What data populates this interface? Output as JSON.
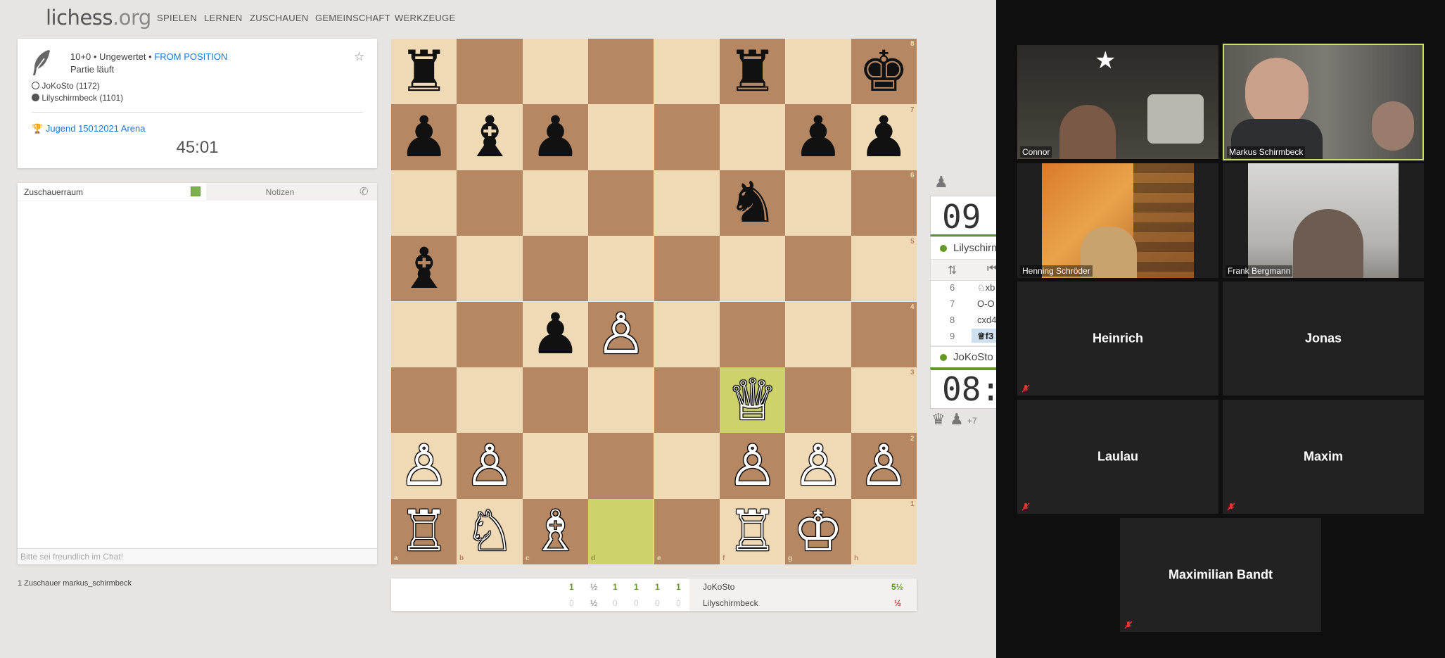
{
  "header": {
    "logo_main": "lichess",
    "logo_tld": ".org",
    "nav": [
      "SPIELEN",
      "LERNEN",
      "ZUSCHAUEN",
      "GEMEINSCHAFT",
      "WERKZEUGE"
    ]
  },
  "game": {
    "setup": "10+0 • Ungewertet •",
    "from_position": "FROM POSITION",
    "status": "Partie läuft",
    "white_player": "JoKoSto (1172)",
    "black_player": "Lilyschirmbeck (1101)",
    "tournament": "Jugend 15012021 Arena",
    "tournament_clock": "45:01"
  },
  "chat": {
    "tab_chat": "Zuschauerraum",
    "tab_notes": "Notizen",
    "placeholder": "Bitte sei freundlich im Chat!",
    "spectators": "1 Zuschauer markus_schirmbeck"
  },
  "board": {
    "files": [
      "a",
      "b",
      "c",
      "d",
      "e",
      "f",
      "g",
      "h"
    ],
    "ranks": [
      "8",
      "7",
      "6",
      "5",
      "4",
      "3",
      "2",
      "1"
    ]
  },
  "crosstable": {
    "row1": [
      "1",
      "½",
      "1",
      "1",
      "1",
      "1"
    ],
    "row2": [
      "0",
      "½",
      "0",
      "0",
      "0",
      "0"
    ],
    "player1": "JoKoSto",
    "player2": "Lilyschirmbeck",
    "score1": "5½",
    "score2": "½"
  },
  "clocks": {
    "top_time": "09",
    "top_player": "Lilyschirm",
    "moves": [
      {
        "num": "6",
        "move": "♘xb"
      },
      {
        "num": "7",
        "move": "O-O"
      },
      {
        "num": "8",
        "move": "cxd4"
      },
      {
        "num": "9",
        "move": "♕f3"
      }
    ],
    "bottom_player": "JoKoSto",
    "bottom_time": "08:",
    "material": "+7"
  },
  "zoom": {
    "tiles": [
      {
        "name": "Connor"
      },
      {
        "name": "Markus Schirmbeck"
      },
      {
        "name": "Henning Schröder"
      },
      {
        "name": "Frank Bergmann"
      },
      {
        "name": "Heinrich"
      },
      {
        "name": "Jonas"
      },
      {
        "name": "Laulau"
      },
      {
        "name": "Maxim"
      },
      {
        "name": "Maximilian Bandt"
      }
    ],
    "active_border_color": "#c8e06a"
  },
  "colors": {
    "board_light": "#f0d9b5",
    "board_dark": "#b58863",
    "highlight": "#cdd26a",
    "link": "#1b78d0",
    "win_green": "#629924",
    "loss_red": "#cc3333"
  }
}
